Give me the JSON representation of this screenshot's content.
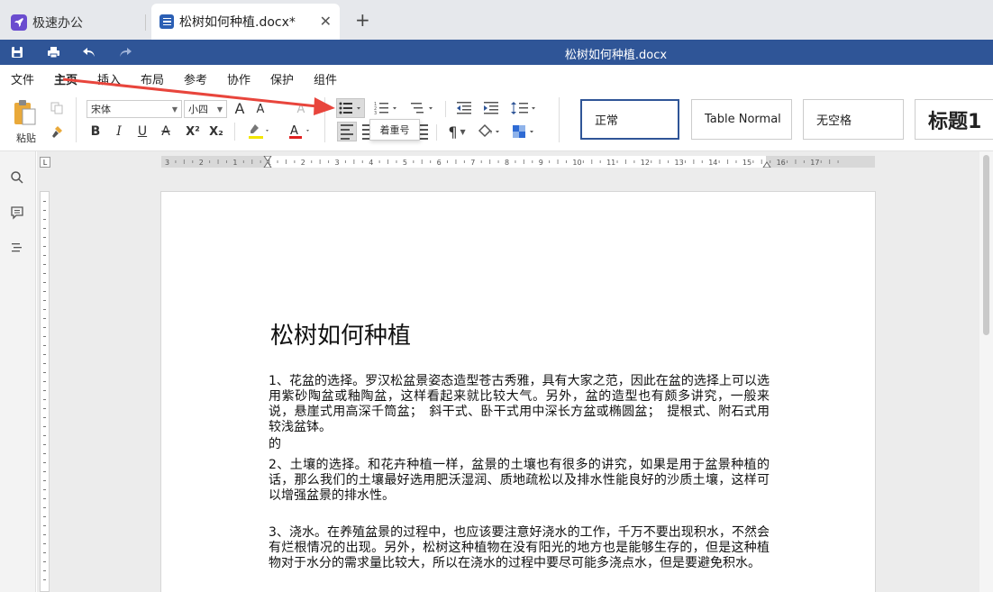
{
  "tabs": {
    "home_tab": "极速办公",
    "doc_tab": "松树如何种植.docx*",
    "close": "✕",
    "new": "+"
  },
  "titlebar": {
    "title": "松树如何种植.docx"
  },
  "menu": [
    "文件",
    "主页",
    "插入",
    "布局",
    "参考",
    "协作",
    "保护",
    "组件"
  ],
  "ribbon": {
    "paste_label": "粘贴",
    "font_name": "宋体",
    "font_size": "小四",
    "grow": "A",
    "shrink": "A",
    "bold": "B",
    "italic": "I",
    "underline": "U",
    "strike": "A",
    "superscript": "X²",
    "subscript": "X₂",
    "font_color": "A",
    "pilcrow": "¶",
    "tooltip": "着重号"
  },
  "styles": [
    "正常",
    "Table Normal",
    "无空格",
    "标题1"
  ],
  "document": {
    "title": "松树如何种植",
    "paragraphs": [
      "1、花盆的选择。罗汉松盆景姿态造型苍古秀雅，具有大家之范，因此在盆的选择上可以选用紫砂陶盆或釉陶盆，这样看起来就比较大气。另外，盆的造型也有颇多讲究，一般来说，悬崖式用高深千筒盆；　斜干式、卧干式用中深长方盆或椭圆盆；　提根式、附石式用较浅盆钵。",
      "的",
      "2、土壤的选择。和花卉种植一样，盆景的土壤也有很多的讲究，如果是用于盆景种植的话，那么我们的土壤最好选用肥沃湿润、质地疏松以及排水性能良好的沙质土壤，这样可以增强盆景的排水性。",
      "3、浇水。在养殖盆景的过程中，也应该要注意好浇水的工作，千万不要出现积水，不然会有烂根情况的出现。另外，松树这种植物在没有阳光的地方也是能够生存的，但是这种植物对于水分的需求量比较大，所以在浇水的过程中要尽可能多浇点水，但是要避免积水。"
    ]
  },
  "ruler": {
    "h_ticks": [
      "3",
      "2",
      "1",
      "1",
      "2",
      "3",
      "4",
      "5",
      "6",
      "7",
      "8",
      "9",
      "10",
      "11",
      "12",
      "13",
      "14",
      "15",
      "16",
      "17"
    ],
    "corner": "L"
  },
  "colors": {
    "titlebar": "#2f5597",
    "annotation_arrow": "#e8453c",
    "app_icon": "#6a4ccf",
    "doc_icon": "#2b5fb4",
    "highlight": "#f2e600",
    "font_color_bar": "#e02020"
  }
}
